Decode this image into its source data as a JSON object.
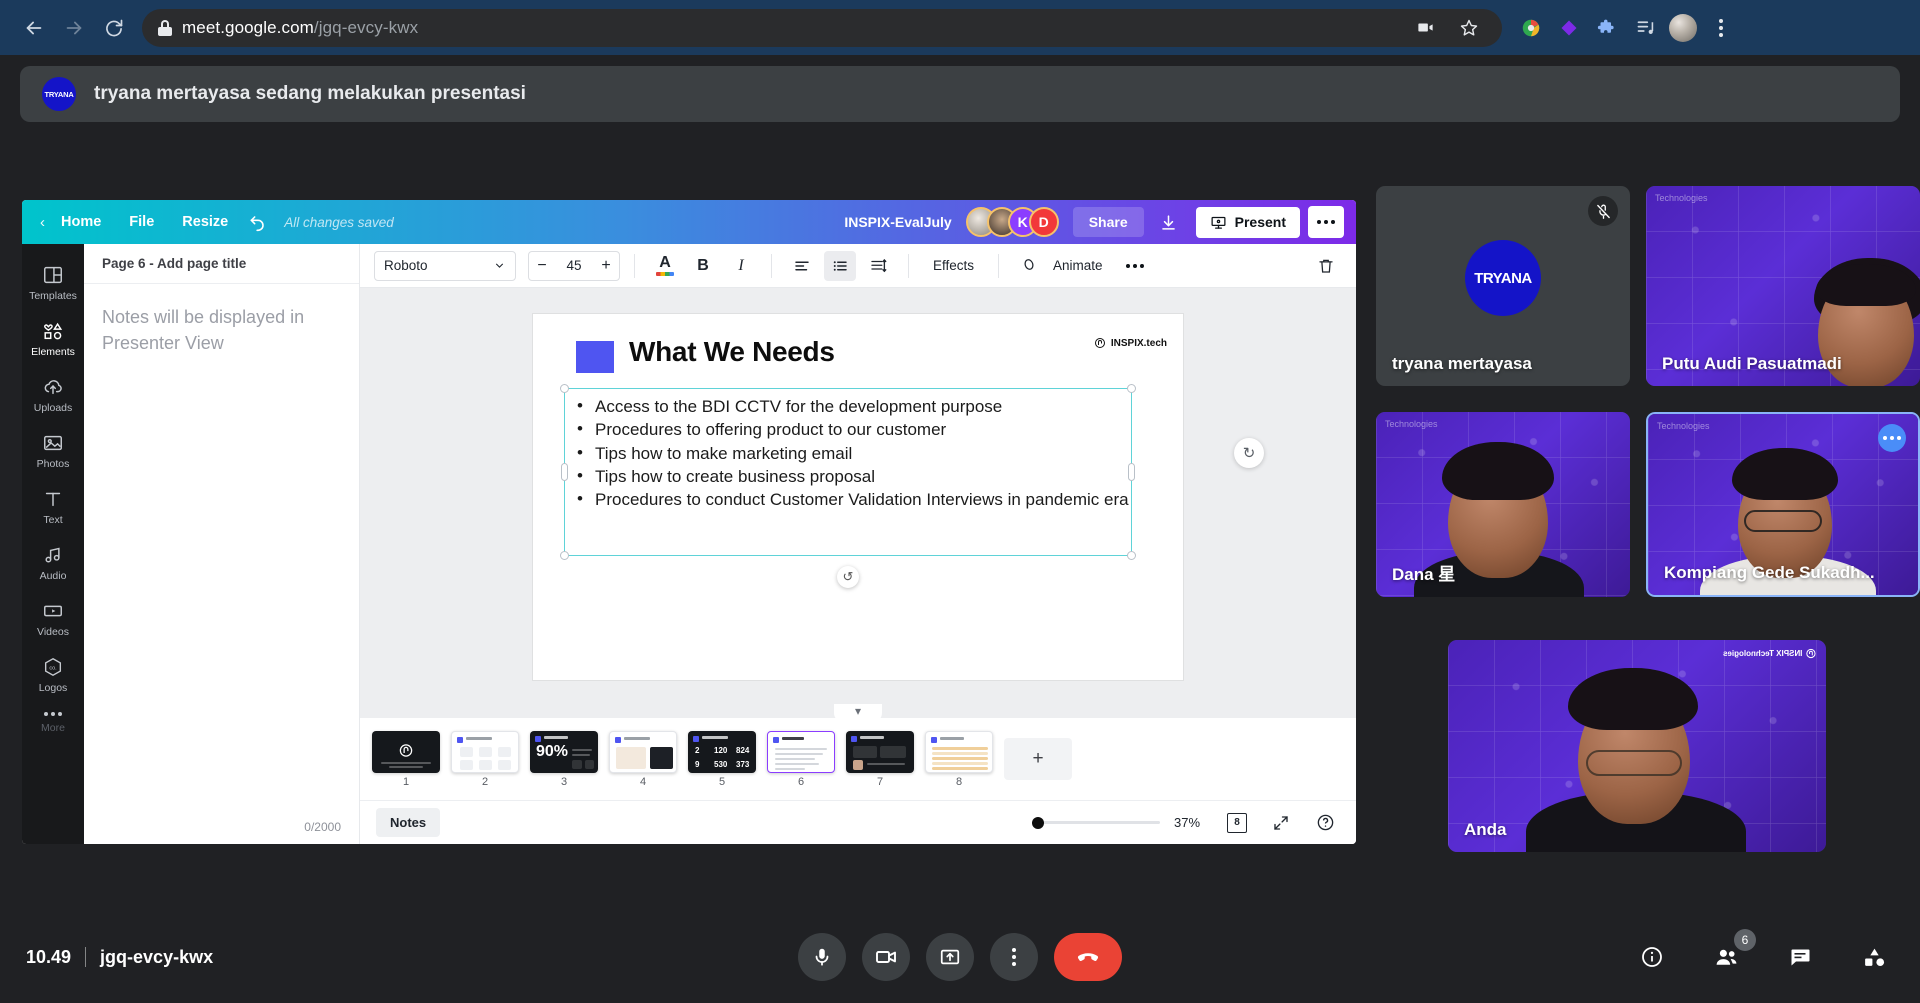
{
  "browser": {
    "url_domain": "meet.google.com",
    "url_path": "/jgq-evcy-kwx",
    "back_icon": "back-arrow-icon",
    "forward_icon": "forward-arrow-icon",
    "reload_icon": "reload-icon",
    "lock_icon": "lock-icon",
    "cast_icon": "video-camera-icon",
    "bookmark_icon": "star-icon",
    "menu_icon": "three-dot-menu-icon"
  },
  "banner": {
    "logo_text": "TRYANA",
    "message": "tryana mertayasa sedang melakukan presentasi"
  },
  "canva": {
    "header": {
      "back_label": "Home",
      "file_label": "File",
      "resize_label": "Resize",
      "undo_icon": "undo-icon",
      "saved_status": "All changes saved",
      "doc_title": "INSPIX-EvalJuly",
      "collaborators": [
        {
          "initial": "",
          "name": "collaborator-1"
        },
        {
          "initial": "",
          "name": "collaborator-2"
        },
        {
          "initial": "K",
          "name": "collaborator-k"
        },
        {
          "initial": "D",
          "name": "collaborator-d"
        }
      ],
      "share_label": "Share",
      "download_icon": "download-icon",
      "present_label": "Present",
      "more_label": "more-options"
    },
    "rail": [
      {
        "label": "Templates",
        "icon": "templates-icon"
      },
      {
        "label": "Elements",
        "icon": "elements-icon"
      },
      {
        "label": "Uploads",
        "icon": "uploads-icon"
      },
      {
        "label": "Photos",
        "icon": "photos-icon"
      },
      {
        "label": "Text",
        "icon": "text-icon"
      },
      {
        "label": "Audio",
        "icon": "audio-icon"
      },
      {
        "label": "Videos",
        "icon": "videos-icon"
      },
      {
        "label": "Logos",
        "icon": "logos-icon"
      },
      {
        "label": "More",
        "icon": "more-icon"
      }
    ],
    "notes": {
      "page_title": "Page 6 - Add page title",
      "placeholder": "Notes will be displayed in Presenter View",
      "char_count": "0/2000"
    },
    "toolbar": {
      "font": "Roboto",
      "font_size": "45",
      "minus": "−",
      "plus": "+",
      "text_color_icon": "text-color-icon",
      "bold_label": "B",
      "italic_label": "I",
      "align_icon": "align-left-icon",
      "list_icon": "bullet-list-icon",
      "spacing_icon": "line-spacing-icon",
      "effects_label": "Effects",
      "animate_label": "Animate",
      "more_label": "more-options",
      "delete_icon": "trash-icon"
    },
    "slide": {
      "title": "What We Needs",
      "brand": "INSPIX.tech",
      "bullets": [
        "Access to the BDI CCTV for the development purpose",
        "Procedures to offering product to our customer",
        "Tips how to make marketing email",
        "Tips how to create business proposal",
        "Procedures to conduct Customer Validation Interviews in pandemic era"
      ]
    },
    "pages": [
      {
        "num": "1",
        "style": "dark"
      },
      {
        "num": "2",
        "style": "light"
      },
      {
        "num": "3",
        "style": "dark"
      },
      {
        "num": "4",
        "style": "light"
      },
      {
        "num": "5",
        "style": "dark"
      },
      {
        "num": "6",
        "style": "light"
      },
      {
        "num": "7",
        "style": "dark"
      },
      {
        "num": "8",
        "style": "light"
      }
    ],
    "page_three_stat": "90%",
    "page_five_stats": [
      "2",
      "120",
      "824",
      "9",
      "530",
      "373"
    ],
    "add_page_label": "+",
    "status": {
      "notes_label": "Notes",
      "zoom": "37%",
      "page_count": "8",
      "fullscreen_icon": "fullscreen-icon",
      "help_icon": "help-icon"
    }
  },
  "tiles": [
    {
      "name": "tryana mertayasa",
      "muted": true,
      "logo": "TRYANA",
      "watermark": ""
    },
    {
      "name": "Putu Audi Pasuatmadi",
      "muted": false,
      "logo": "",
      "watermark": "Technologies"
    },
    {
      "name": "Dana 星",
      "muted": false,
      "logo": "",
      "watermark": "Technologies"
    },
    {
      "name": "Kompiang Gede Sukadh...",
      "muted": false,
      "logo": "",
      "watermark": "Technologies",
      "active": true
    },
    {
      "name": "Anda",
      "muted": false,
      "logo": "",
      "watermark": "INSPIX Technologies"
    }
  ],
  "meet_bar": {
    "time": "10.49",
    "meeting_code": "jgq-evcy-kwx",
    "mic_icon": "microphone-icon",
    "camera_icon": "camera-icon",
    "present_icon": "present-screen-icon",
    "more_icon": "more-options-icon",
    "hangup_icon": "end-call-icon",
    "info_icon": "meeting-details-icon",
    "people_icon": "people-icon",
    "people_count": "6",
    "chat_icon": "chat-icon",
    "activities_icon": "activities-icon"
  }
}
